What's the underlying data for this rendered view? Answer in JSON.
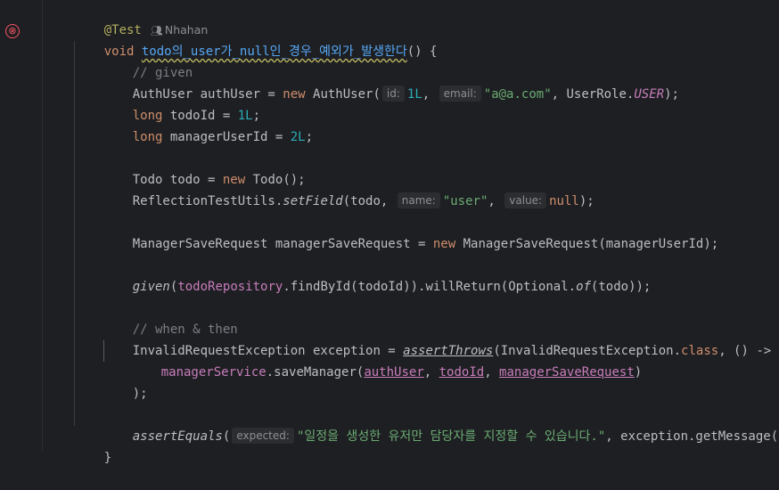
{
  "annotation": "@Test",
  "author": "Nhahan",
  "error_icon": "⊗",
  "method": {
    "modifier": "void",
    "name": "todo의_user가_null인_경우_예외가_발생한다",
    "open": "() {"
  },
  "lines": {
    "given_comment": "// given",
    "auth_user_type": "AuthUser authUser = ",
    "new": "new",
    "auth_user_ctor": " AuthUser(",
    "hint_id": "id:",
    "val_1L": "1L",
    "comma": ",",
    "hint_email": "email:",
    "email_str": "\"a@a.com\"",
    "user_role": ", UserRole.",
    "user_const": "USER",
    "close_paren_semi": ");",
    "long": "long",
    "todo_id": " todoId = ",
    "semi": ";",
    "manager_user_id": " managerUserId = ",
    "val_2L": "2L",
    "todo_decl": "Todo todo = ",
    "todo_ctor": " Todo();",
    "reflection": "ReflectionTestUtils.",
    "set_field": "setField",
    "set_field_args": "(todo,",
    "hint_name": "name:",
    "user_str": "\"user\"",
    "hint_value": "value:",
    "null": "null",
    "msr_decl": "ManagerSaveRequest managerSaveRequest = ",
    "msr_ctor": " ManagerSaveRequest(managerUserId);",
    "given": "given",
    "todo_repo": "todoRepository",
    "find_by_id": ".findById(todoId)).willReturn(Optional.",
    "of": "of",
    "of_args": "(todo));",
    "when_comment": "// when & then",
    "exception_decl": "InvalidRequestException exception = ",
    "assert_throws": "assertThrows",
    "assert_throws_args": "(InvalidRequestException.",
    "class": "class",
    "lambda": ", () ->",
    "manager_service": "managerService",
    "save_manager": ".saveManager(",
    "arg_auth_user": "authUser",
    "arg_sep": ", ",
    "arg_todo_id": "todoId",
    "arg_msr": "managerSaveRequest",
    "close_paren": ")",
    "assert_equals": "assertEquals",
    "open_paren": "(",
    "hint_expected": "expected:",
    "message_str": "\"일정을 생성한 유저만 담당자를 지정할 수 있습니다.\"",
    "get_message": ", exception.getMessage());",
    "close_brace": "}"
  }
}
